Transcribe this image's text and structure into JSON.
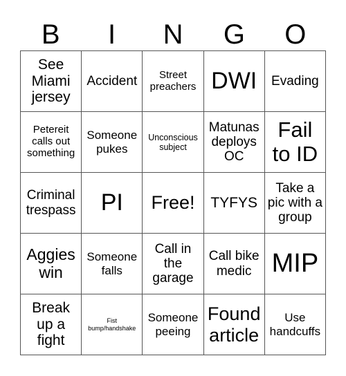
{
  "header": [
    "B",
    "I",
    "N",
    "G",
    "O"
  ],
  "cells": [
    [
      "See Miami jersey",
      "Accident",
      "Street preachers",
      "DWI",
      "Evading"
    ],
    [
      "Petereit calls out something",
      "Someone pukes",
      "Unconscious subject",
      "Matunas deploys OC",
      "Fail to ID"
    ],
    [
      "Criminal trespass",
      "PI",
      "Free!",
      "TYFYS",
      "Take a pic with a group"
    ],
    [
      "Aggies win",
      "Someone falls",
      "Call in the garage",
      "Call bike medic",
      "MIP"
    ],
    [
      "Break up a fight",
      "Fist bump/handshake",
      "Someone peeing",
      "Found article",
      "Use handcuffs"
    ]
  ]
}
